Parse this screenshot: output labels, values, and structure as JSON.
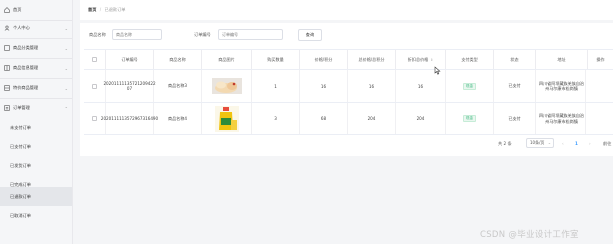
{
  "sidebar": {
    "home": "首页",
    "personal_center": "个人中心",
    "product_category": "商品分类管理",
    "product_info": "商品信息管理",
    "sale_product": "特价商品管理",
    "order_mgmt": "订单管理",
    "sub_items": [
      "未支付订单",
      "已支付订单",
      "已发货订单",
      "已完成订单",
      "已退款订单",
      "已取消订单"
    ]
  },
  "breadcrumb": {
    "home": "首页",
    "separator": "/",
    "current": "已退款订单"
  },
  "filters": {
    "product_name_label": "商品名称",
    "product_name_placeholder": "商品名称",
    "order_no_label": "订单编号",
    "order_no_placeholder": "订单编号",
    "query_button": "查询"
  },
  "table": {
    "columns": [
      "订单编号",
      "商品名称",
      "商品图片",
      "购买数量",
      "价格/积分",
      "总价格/总积分",
      "折扣总价格",
      "支付类型",
      "状态",
      "地址",
      "操作"
    ],
    "rows": [
      {
        "order_no": "20201111135721209422 07",
        "product_name": "商品名称3",
        "quantity": "1",
        "price": "16",
        "total": "16",
        "discount_total": "16",
        "pay_type": "现金",
        "status": "已支付",
        "address": "四川省阿坝藏族羌族自治州马尔康市松岗镇"
      },
      {
        "order_no": "2020111113572967316490",
        "product_name": "商品名称4",
        "quantity": "3",
        "price": "68",
        "total": "204",
        "discount_total": "204",
        "pay_type": "现金",
        "status": "已支付",
        "address": "四川省阿坝藏族羌族自治州马尔康市松岗镇"
      }
    ]
  },
  "pagination": {
    "total": "共 2 条",
    "page_size": "10条/页",
    "prev": "‹",
    "page": "1",
    "next": "›",
    "goto": "前往"
  },
  "watermark": "CSDN @毕业设计工作室",
  "colors": {
    "accent": "#409eff",
    "tag_green": "#42b983",
    "sidebar_bg": "#f5f6f8"
  }
}
